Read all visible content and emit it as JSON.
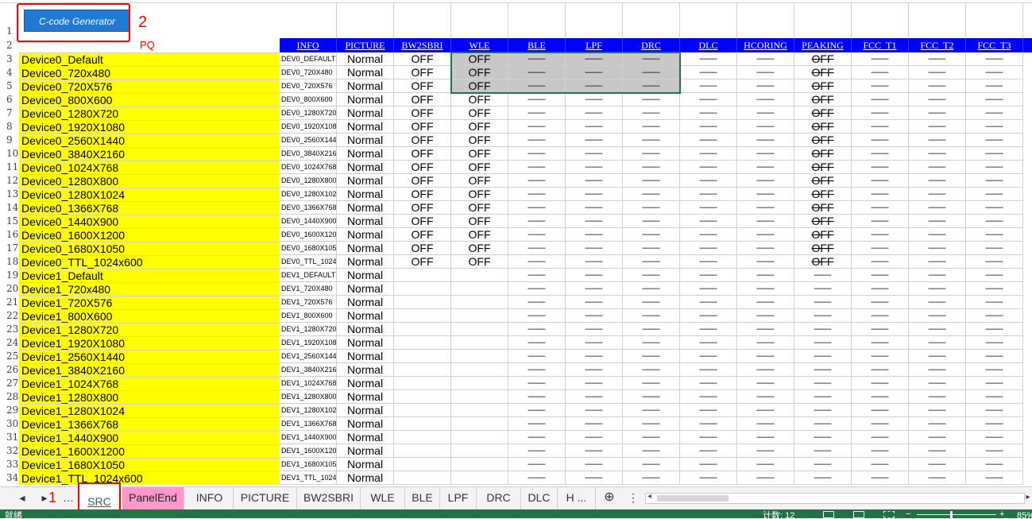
{
  "button": {
    "label": "C-code Generator"
  },
  "annotations": {
    "button_num": "2",
    "tab_num": "1"
  },
  "pq_label": "PQ",
  "columns": [
    "INFO",
    "PICTURE",
    "BW2SBRI",
    "WLE",
    "BLE",
    "LPF",
    "DRC",
    "DLC",
    "HCORING",
    "PEAKING",
    "FCC_T1",
    "FCC_T2",
    "FCC_T3"
  ],
  "colors": {
    "header_bg": "#0000ff",
    "device_bg": "#ffff00",
    "status_bar": "#217346",
    "active_tab_bg": "#ffffff",
    "paneltab_bg": "#ff99cc",
    "highlight_red": "#ff0000"
  },
  "rows": [
    {
      "num": "1"
    },
    {
      "num": "2"
    },
    {
      "num": "3",
      "name": "Device0_Default",
      "info": "DEV0_DEFAULT",
      "picture": "Normal",
      "bw": "OFF",
      "wle": "OFF"
    },
    {
      "num": "4",
      "name": "Device0_720x480",
      "info": "DEV0_720X480",
      "picture": "Normal",
      "bw": "OFF",
      "wle": "OFF"
    },
    {
      "num": "5",
      "name": "Device0_720X576",
      "info": "DEV0_720X576",
      "picture": "Normal",
      "bw": "OFF",
      "wle": "OFF"
    },
    {
      "num": "6",
      "name": "Device0_800X600",
      "info": "DEV0_800X600",
      "picture": "Normal",
      "bw": "OFF",
      "wle": "OFF"
    },
    {
      "num": "7",
      "name": "Device0_1280X720",
      "info": "DEV0_1280X720",
      "picture": "Normal",
      "bw": "OFF",
      "wle": "OFF"
    },
    {
      "num": "8",
      "name": "Device0_1920X1080",
      "info": "DEV0_1920X1080",
      "picture": "Normal",
      "bw": "OFF",
      "wle": "OFF"
    },
    {
      "num": "9",
      "name": "Device0_2560X1440",
      "info": "DEV0_2560X1440",
      "picture": "Normal",
      "bw": "OFF",
      "wle": "OFF"
    },
    {
      "num": "10",
      "name": "Device0_3840X2160",
      "info": "DEV0_3840X2160",
      "picture": "Normal",
      "bw": "OFF",
      "wle": "OFF"
    },
    {
      "num": "11",
      "name": "Device0_1024X768",
      "info": "DEV0_1024X768",
      "picture": "Normal",
      "bw": "OFF",
      "wle": "OFF"
    },
    {
      "num": "12",
      "name": "Device0_1280X800",
      "info": "DEV0_1280X800",
      "picture": "Normal",
      "bw": "OFF",
      "wle": "OFF"
    },
    {
      "num": "13",
      "name": "Device0_1280X1024",
      "info": "DEV0_1280X1024",
      "picture": "Normal",
      "bw": "OFF",
      "wle": "OFF"
    },
    {
      "num": "14",
      "name": "Device0_1366X768",
      "info": "DEV0_1366X768",
      "picture": "Normal",
      "bw": "OFF",
      "wle": "OFF"
    },
    {
      "num": "15",
      "name": "Device0_1440X900",
      "info": "DEV0_1440X900",
      "picture": "Normal",
      "bw": "OFF",
      "wle": "OFF"
    },
    {
      "num": "16",
      "name": "Device0_1600X1200",
      "info": "DEV0_1600X1200",
      "picture": "Normal",
      "bw": "OFF",
      "wle": "OFF"
    },
    {
      "num": "17",
      "name": "Device0_1680X1050",
      "info": "DEV0_1680X1050",
      "picture": "Normal",
      "bw": "OFF",
      "wle": "OFF"
    },
    {
      "num": "18",
      "name": "Device0_TTL_1024x600",
      "info": "DEV0_TTL_1024x600",
      "picture": "Normal",
      "bw": "OFF",
      "wle": "OFF"
    },
    {
      "num": "19",
      "name": "Device1_Default",
      "info": "DEV1_DEFAULT",
      "picture": "Normal"
    },
    {
      "num": "20",
      "name": "Device1_720x480",
      "info": "DEV1_720X480",
      "picture": "Normal"
    },
    {
      "num": "21",
      "name": "Device1_720X576",
      "info": "DEV1_720X576",
      "picture": "Normal"
    },
    {
      "num": "22",
      "name": "Device1_800X600",
      "info": "DEV1_800X600",
      "picture": "Normal"
    },
    {
      "num": "23",
      "name": "Device1_1280X720",
      "info": "DEV1_1280X720",
      "picture": "Normal"
    },
    {
      "num": "24",
      "name": "Device1_1920X1080",
      "info": "DEV1_1920X1080",
      "picture": "Normal"
    },
    {
      "num": "25",
      "name": "Device1_2560X1440",
      "info": "DEV1_2560X1440",
      "picture": "Normal"
    },
    {
      "num": "26",
      "name": "Device1_3840X2160",
      "info": "DEV1_3840X2160",
      "picture": "Normal"
    },
    {
      "num": "27",
      "name": "Device1_1024X768",
      "info": "DEV1_1024X768",
      "picture": "Normal"
    },
    {
      "num": "28",
      "name": "Device1_1280X800",
      "info": "DEV1_1280X800",
      "picture": "Normal"
    },
    {
      "num": "29",
      "name": "Device1_1280X1024",
      "info": "DEV1_1280X1024",
      "picture": "Normal"
    },
    {
      "num": "30",
      "name": "Device1_1366X768",
      "info": "DEV1_1366X768",
      "picture": "Normal"
    },
    {
      "num": "31",
      "name": "Device1_1440X900",
      "info": "DEV1_1440X900",
      "picture": "Normal"
    },
    {
      "num": "32",
      "name": "Device1_1600X1200",
      "info": "DEV1_1600X1200",
      "picture": "Normal"
    },
    {
      "num": "33",
      "name": "Device1_1680X1050",
      "info": "DEV1_1680X1050",
      "picture": "Normal"
    },
    {
      "num": "34",
      "name": "Device1_TTL_1024x600",
      "info": "DEV1_TTL_1024x600",
      "picture": "Normal"
    }
  ],
  "dash_text": "——",
  "peaking_value": "OFF",
  "tabs": [
    "SRC",
    "PanelEnd",
    "INFO",
    "PICTURE",
    "BW2SBRI",
    "WLE",
    "BLE",
    "LPF",
    "DRC",
    "DLC",
    "H ..."
  ],
  "status": {
    "ready": "就绪",
    "count": "计数: 12",
    "zoom": "85%"
  }
}
